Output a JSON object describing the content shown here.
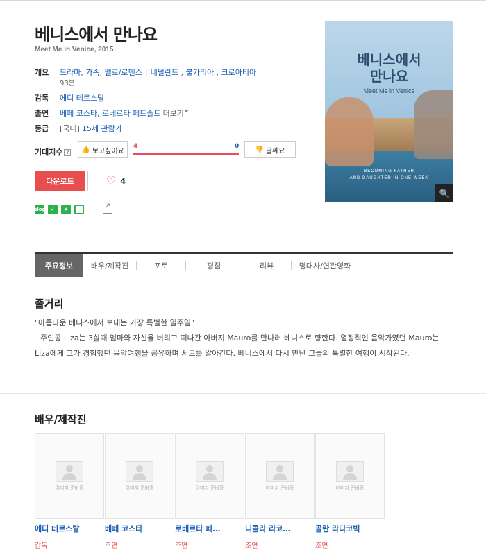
{
  "movie": {
    "title": "베니스에서 만나요",
    "subtitle": "Meet Me in Venice, 2015"
  },
  "info": {
    "overview_label": "개요",
    "genre": "드라마, 가족, 멜로/로맨스",
    "countries": "네덜란드 , 불가리아 , 크로아티아",
    "runtime": "93분",
    "director_label": "감독",
    "director": "에디 테르스탈",
    "cast_label": "출연",
    "cast": "베페 코스타, 로베르타 페트졸트",
    "more": "더보기",
    "rating_label": "등급",
    "rating_prefix": "[국내]",
    "rating": "15세 관람가"
  },
  "expect": {
    "label": "기대지수",
    "want_label": "보고싶어요",
    "nah_label": "글쎄요",
    "want_count": "4",
    "nah_count": "0",
    "want_ratio": 1.0
  },
  "actions": {
    "download_label": "다운로드",
    "like_count": "4"
  },
  "poster": {
    "title_line1": "베니스에서",
    "title_line2": "만나요",
    "eng_title": "Meet Me in Venice",
    "tagline_line1": "BECOMING FATHER",
    "tagline_line2": "AND DAUGHTER IN ONE WEEK"
  },
  "tabs": [
    {
      "label": "주요정보",
      "active": true
    },
    {
      "label": "배우/제작진"
    },
    {
      "label": "포토"
    },
    {
      "label": "평점"
    },
    {
      "label": "리뷰"
    },
    {
      "label": "명대사/연관영화"
    }
  ],
  "synopsis": {
    "heading": "줄거리",
    "quote": "\"아름다운 베니스에서 보내는 가장 특별한 일주일\"",
    "body": "주인공 Liza는 3살때 엄마와 자신을 버리고 떠나간 아버지 Mauro를 만나러 베니스로 향한다. 열정적인 음악가였던 Mauro는 Liza에게 그가 경험했던 음악여행을 공유하며 서로를 알아간다. 베니스에서 다시 만난 그들의 특별한 여행이 시작된다."
  },
  "cast_section": {
    "heading": "배우/제작진",
    "no_image_text": "이미지 준비중",
    "people": [
      {
        "name": "에디 테르스탈",
        "role": "감독"
      },
      {
        "name": "베페 코스타",
        "role": "주연"
      },
      {
        "name": "로베르타 페…",
        "role": "주연"
      },
      {
        "name": "니콜라 라코…",
        "role": "조연"
      },
      {
        "name": "골란 라다코빅",
        "role": "조연"
      }
    ]
  }
}
